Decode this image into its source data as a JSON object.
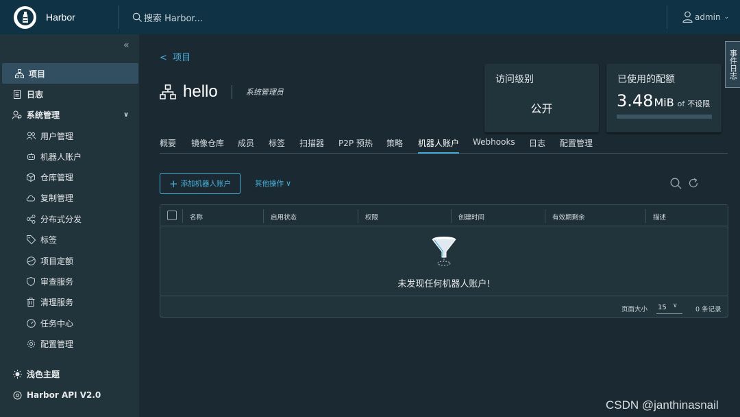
{
  "header": {
    "brand": "Harbor",
    "search_placeholder": "搜索 Harbor...",
    "user": "admin"
  },
  "sidebar": {
    "items": [
      {
        "label": "项目",
        "icon": "project-icon",
        "active": true
      },
      {
        "label": "日志",
        "icon": "log-icon"
      },
      {
        "label": "系统管理",
        "icon": "admin-icon",
        "expanded": true
      },
      {
        "label": "用户管理",
        "icon": "users-icon",
        "sub": true
      },
      {
        "label": "机器人账户",
        "icon": "robot-icon",
        "sub": true
      },
      {
        "label": "仓库管理",
        "icon": "cube-icon",
        "sub": true
      },
      {
        "label": "复制管理",
        "icon": "cloud-icon",
        "sub": true
      },
      {
        "label": "分布式分发",
        "icon": "share-icon",
        "sub": true
      },
      {
        "label": "标签",
        "icon": "tag-icon",
        "sub": true
      },
      {
        "label": "项目定额",
        "icon": "quota-icon",
        "sub": true
      },
      {
        "label": "审查服务",
        "icon": "shield-icon",
        "sub": true
      },
      {
        "label": "清理服务",
        "icon": "trash-icon",
        "sub": true
      },
      {
        "label": "任务中心",
        "icon": "dashboard-icon",
        "sub": true
      },
      {
        "label": "配置管理",
        "icon": "gear-icon",
        "sub": true
      }
    ],
    "theme_label": "浅色主题",
    "api_label": "Harbor API V2.0"
  },
  "main": {
    "back_label": "项目",
    "project_name": "hello",
    "role": "系统管理员",
    "access_card": {
      "label": "访问级别",
      "value": "公开"
    },
    "quota_card": {
      "label": "已使用的配额",
      "used": "3.48",
      "unit": "MiB",
      "of": "of",
      "limit": "不设限"
    },
    "event_rail": "事件日志",
    "tabs": [
      "概要",
      "镜像仓库",
      "成员",
      "标签",
      "扫描器",
      "P2P 预热",
      "策略",
      "机器人账户",
      "Webhooks",
      "日志",
      "配置管理"
    ],
    "active_tab": "机器人账户",
    "add_button": "添加机器人账户",
    "other_actions": "其他操作",
    "table": {
      "columns": [
        "名称",
        "启用状态",
        "权限",
        "创建时间",
        "有效期剩余",
        "描述"
      ],
      "empty_text": "未发现任何机器人账户!",
      "page_size_label": "页面大小",
      "page_size": "15",
      "record_count": "0 条记录"
    }
  },
  "watermark": "CSDN @janthinasnail"
}
